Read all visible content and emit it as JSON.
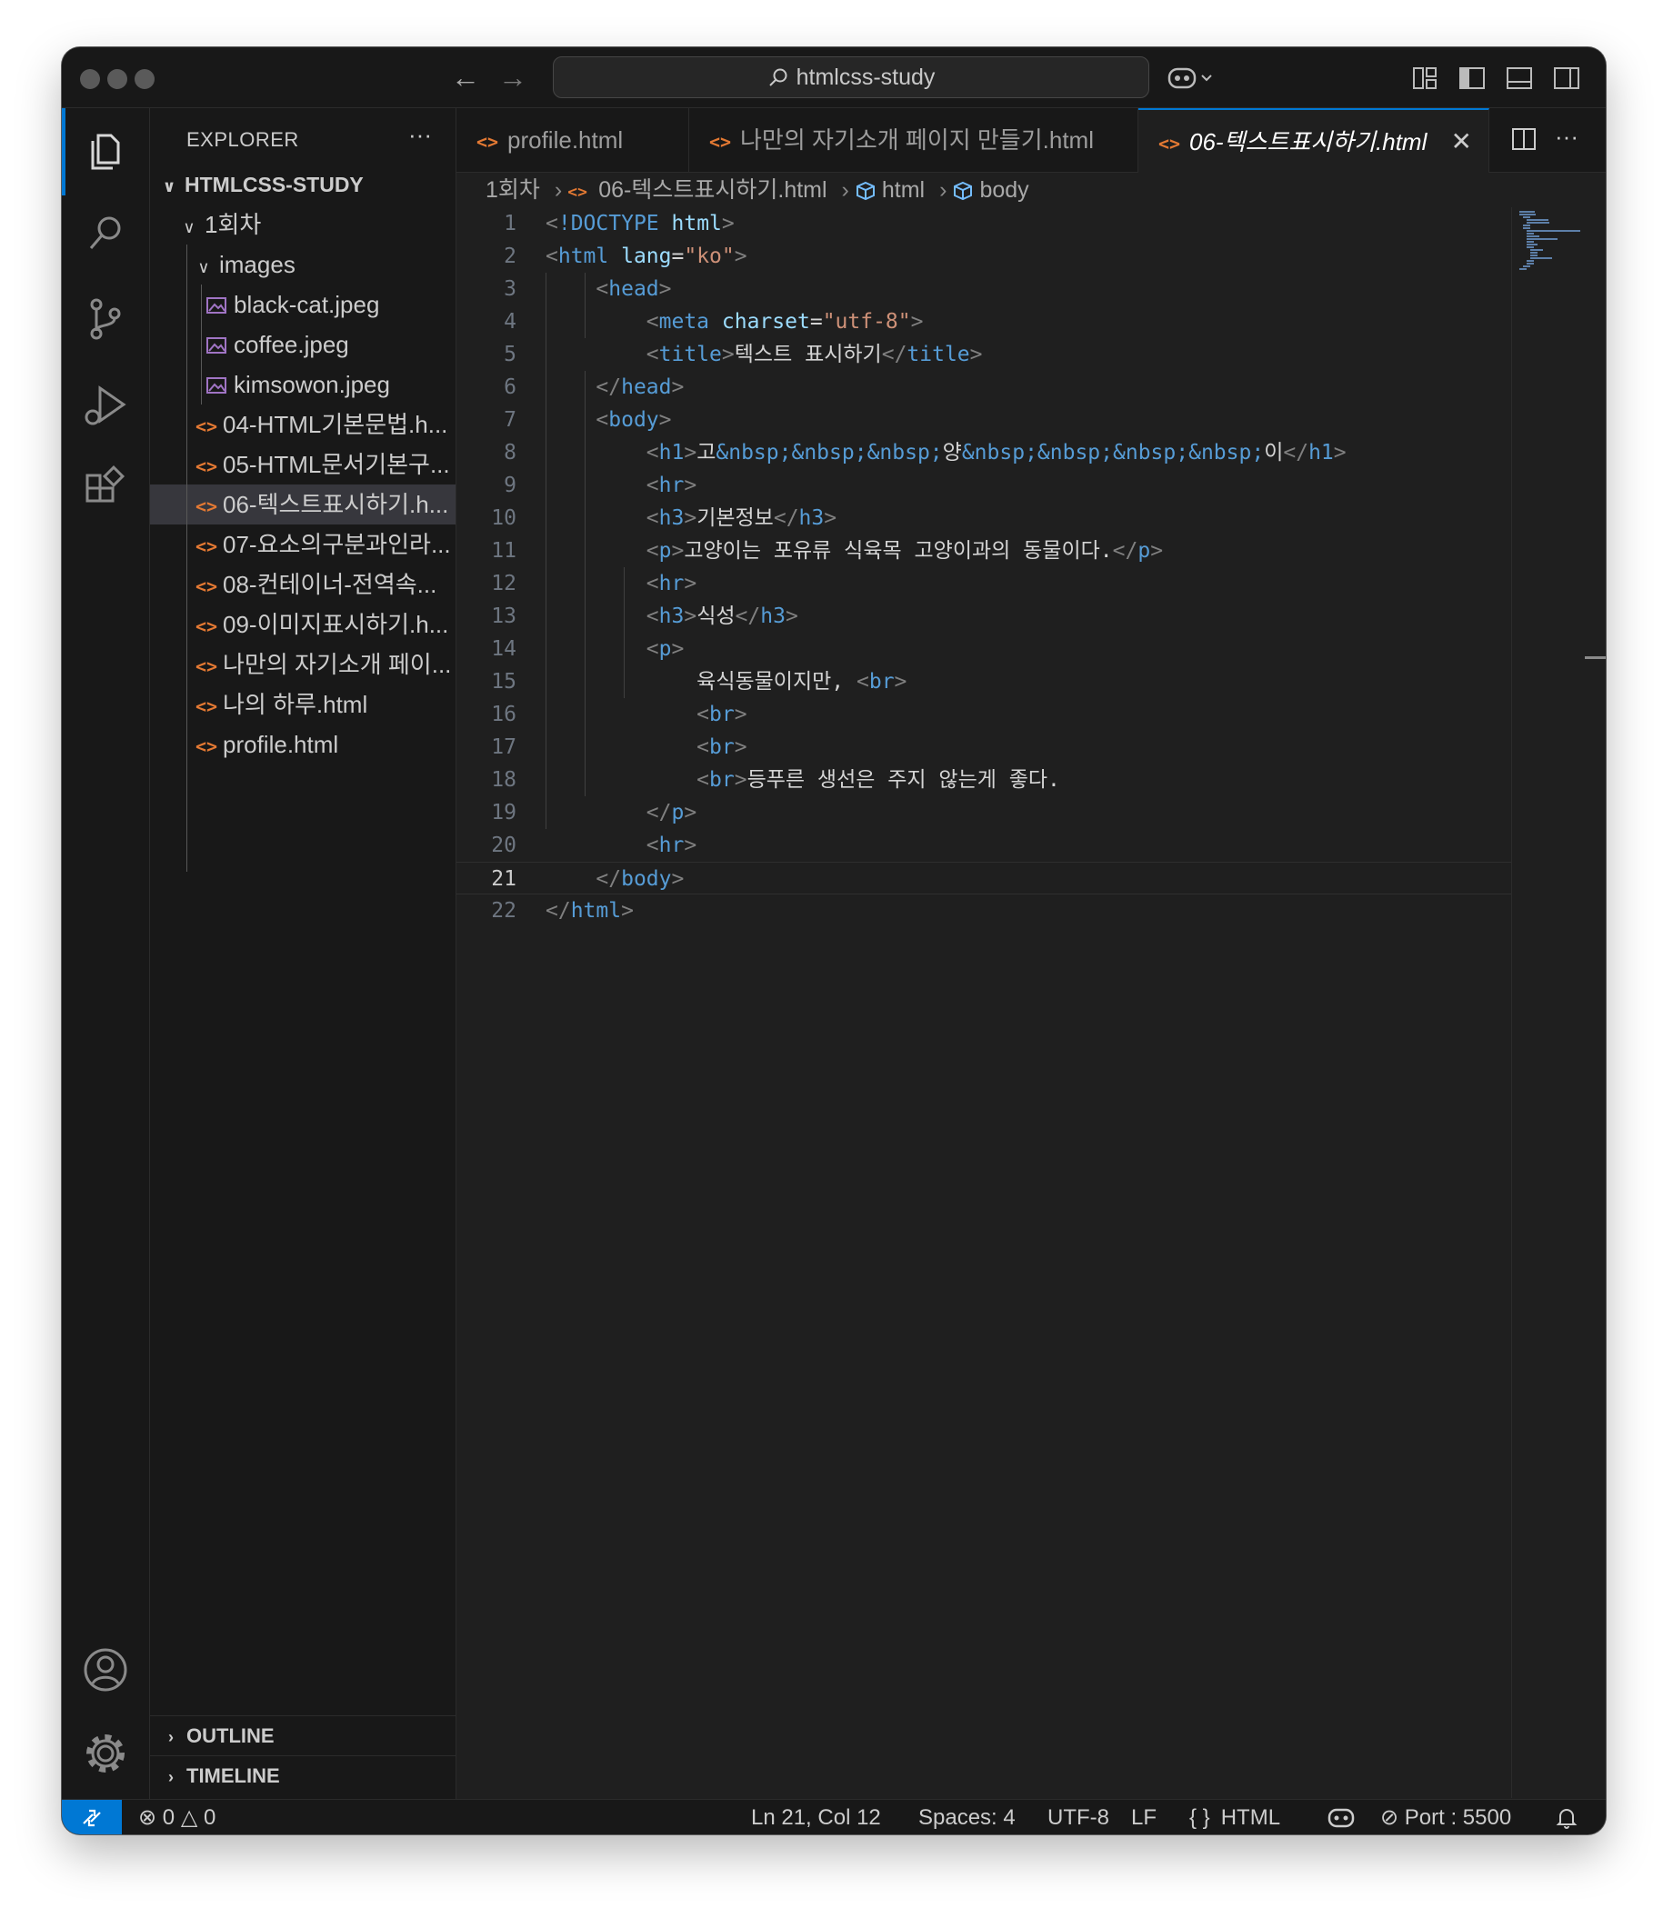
{
  "window": {
    "search_text": "htmlcss-study"
  },
  "activity_bar": {
    "items": [
      "files-icon",
      "search-icon",
      "source-control-icon",
      "run-debug-icon",
      "extensions-icon"
    ],
    "bottom": [
      "account-icon",
      "settings-gear-icon"
    ]
  },
  "explorer": {
    "title": "EXPLORER",
    "root": "HTMLCSS-STUDY",
    "folder": "1회차",
    "subfolder": "images",
    "images": [
      "black-cat.jpeg",
      "coffee.jpeg",
      "kimsowon.jpeg"
    ],
    "files": [
      "04-HTML기본문법.h...",
      "05-HTML문서기본구...",
      "06-텍스트표시하기.h...",
      "07-요소의구분과인라...",
      "08-컨테이너-전역속...",
      "09-이미지표시하기.h...",
      "나만의 자기소개 페이...",
      "나의 하루.html",
      "profile.html"
    ],
    "selected_index": 2,
    "outline": "OUTLINE",
    "timeline": "TIMELINE"
  },
  "tabs": [
    {
      "label": "profile.html",
      "active": false
    },
    {
      "label": "나만의 자기소개 페이지 만들기.html",
      "active": false
    },
    {
      "label": "06-텍스트표시하기.html",
      "active": true
    }
  ],
  "breadcrumb": [
    "1회차",
    "06-텍스트표시하기.html",
    "html",
    "body"
  ],
  "editor": {
    "current_line": 21,
    "lines": [
      "<!DOCTYPE html>",
      "<html lang=\"ko\">",
      "    <head>",
      "        <meta charset=\"utf-8\">",
      "        <title>텍스트 표시하기</title>",
      "    </head>",
      "    <body>",
      "        <h1>고&nbsp;&nbsp;&nbsp;양&nbsp;&nbsp;&nbsp;&nbsp;이</h1>",
      "        <hr>",
      "        <h3>기본정보</h3>",
      "        <p>고양이는 포유류 식육목 고양이과의 동물이다.</p>",
      "        <hr>",
      "        <h3>식성</h3>",
      "        <p>",
      "            육식동물이지만, <br>",
      "            <br>",
      "            <br>",
      "            <br>등푸른 생선은 주지 않는게 좋다.",
      "        </p>",
      "        <hr>",
      "    </body>",
      "</html>"
    ]
  },
  "statusbar": {
    "errors": "0",
    "warnings": "0",
    "position": "Ln 21, Col 12",
    "spaces": "Spaces: 4",
    "encoding": "UTF-8",
    "eol": "LF",
    "language": "HTML",
    "port": "Port : 5500"
  }
}
